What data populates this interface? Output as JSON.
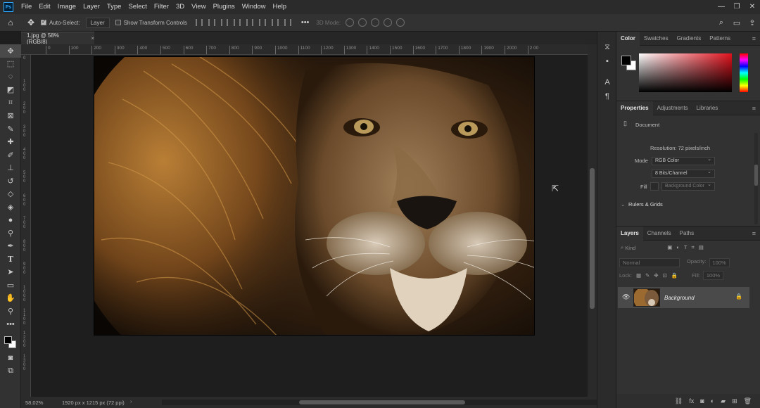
{
  "menubar": {
    "logo": "Ps",
    "items": [
      "File",
      "Edit",
      "Image",
      "Layer",
      "Type",
      "Select",
      "Filter",
      "3D",
      "View",
      "Plugins",
      "Window",
      "Help"
    ]
  },
  "options": {
    "auto_select_label": "Auto-Select:",
    "auto_select_value": "Layer",
    "transform_label": "Show Transform Controls",
    "mode_3d_label": "3D Mode:"
  },
  "document_tab": {
    "title": "1.jpg @ 58% (RGB/8)",
    "close": "×"
  },
  "ruler": {
    "top_ticks": [
      "0",
      "100",
      "200",
      "300",
      "400",
      "500",
      "600",
      "700",
      "800",
      "900",
      "1000",
      "1100",
      "1200",
      "1300",
      "1400",
      "1500",
      "1600",
      "1700",
      "1800",
      "1900",
      "2000",
      "2 00"
    ],
    "left_ticks": [
      "0",
      "1 0 0",
      "2 0 0",
      "3 0 0",
      "4 0 0",
      "5 0 0",
      "6 0 0",
      "7 0 0",
      "8 0 0",
      "9 0 0",
      "1 0 0 0",
      "1 1 0 0",
      "1 2 0 0",
      "1 3 0 0"
    ]
  },
  "status": {
    "zoom": "58,02%",
    "doc_info": "1920 px x 1215 px (72 ppi)"
  },
  "color_panel": {
    "tabs": [
      "Color",
      "Swatches",
      "Gradients",
      "Patterns"
    ],
    "foreground": "#000000",
    "background": "#ffffff",
    "hue_color": "#e2121d"
  },
  "properties_panel": {
    "tabs": [
      "Properties",
      "Adjustments",
      "Libraries"
    ],
    "section": "Document",
    "resolution": "Resolution: 72 pixels/inch",
    "mode_label": "Mode",
    "mode_value": "RGB Color",
    "bits_value": "8 Bits/Channel",
    "fill_label": "Fill",
    "fill_value": "Background Color",
    "rulers_section": "Rulers & Grids"
  },
  "layers_panel": {
    "tabs": [
      "Layers",
      "Channels",
      "Paths"
    ],
    "filter_label": "Kind",
    "blend_mode": "Normal",
    "opacity_label": "Opacity:",
    "opacity_value": "100%",
    "lock_label": "Lock:",
    "fill_label": "Fill:",
    "fill_value": "100%",
    "layer_name": "Background"
  }
}
